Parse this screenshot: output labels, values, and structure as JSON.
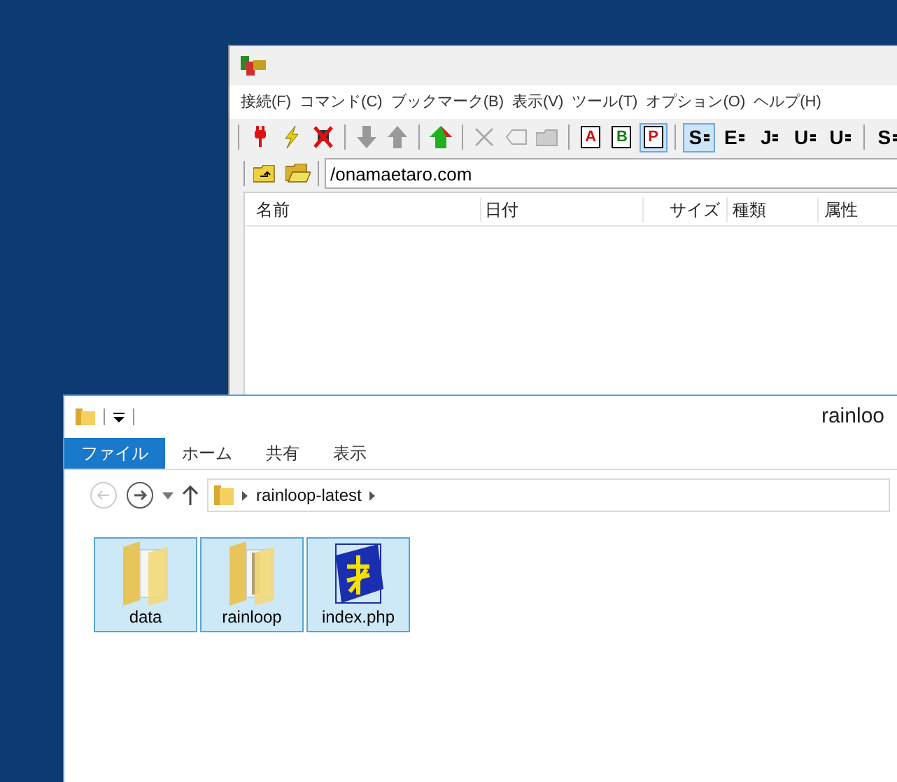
{
  "ftp_window": {
    "menu": [
      "接続(F)",
      "コマンド(C)",
      "ブックマーク(B)",
      "表示(V)",
      "ツール(T)",
      "オプション(O)",
      "ヘルプ(H)"
    ],
    "toolbar": [
      {
        "kind": "plug"
      },
      {
        "kind": "bolt"
      },
      {
        "kind": "cross-plug"
      },
      {
        "kind": "sep"
      },
      {
        "kind": "down"
      },
      {
        "kind": "up"
      },
      {
        "kind": "sep"
      },
      {
        "kind": "home"
      },
      {
        "kind": "sep"
      },
      {
        "kind": "delete"
      },
      {
        "kind": "rename"
      },
      {
        "kind": "folder-add"
      },
      {
        "kind": "sep"
      },
      {
        "kind": "letter",
        "glyph": "A",
        "color": "#d01010",
        "selected": false
      },
      {
        "kind": "letter",
        "glyph": "B",
        "color": "#108010",
        "selected": false
      },
      {
        "kind": "letter",
        "glyph": "P",
        "color": "#d01010",
        "selected": true
      },
      {
        "kind": "sep"
      },
      {
        "kind": "enc",
        "glyph": "S",
        "selected": true
      },
      {
        "kind": "enc",
        "glyph": "E",
        "selected": false
      },
      {
        "kind": "enc",
        "glyph": "J",
        "selected": false
      },
      {
        "kind": "enc",
        "glyph": "U",
        "selected": false
      },
      {
        "kind": "enc",
        "glyph": "U",
        "selected": false
      },
      {
        "kind": "sep"
      },
      {
        "kind": "enc",
        "glyph": "S",
        "selected": false
      }
    ],
    "path": "/onamaetaro.com",
    "columns": [
      "名前",
      "日付",
      "サイズ",
      "種類",
      "属性"
    ]
  },
  "explorer": {
    "title": "rainloo",
    "ribbon_tabs": [
      {
        "label": "ファイル",
        "selected": true
      },
      {
        "label": "ホーム",
        "selected": false
      },
      {
        "label": "共有",
        "selected": false
      },
      {
        "label": "表示",
        "selected": false
      }
    ],
    "breadcrumb": "rainloop-latest",
    "items": [
      {
        "kind": "folder",
        "name": "data",
        "selected": true
      },
      {
        "kind": "folder-files",
        "name": "rainloop",
        "selected": true
      },
      {
        "kind": "php",
        "name": "index.php",
        "selected": true
      }
    ]
  }
}
